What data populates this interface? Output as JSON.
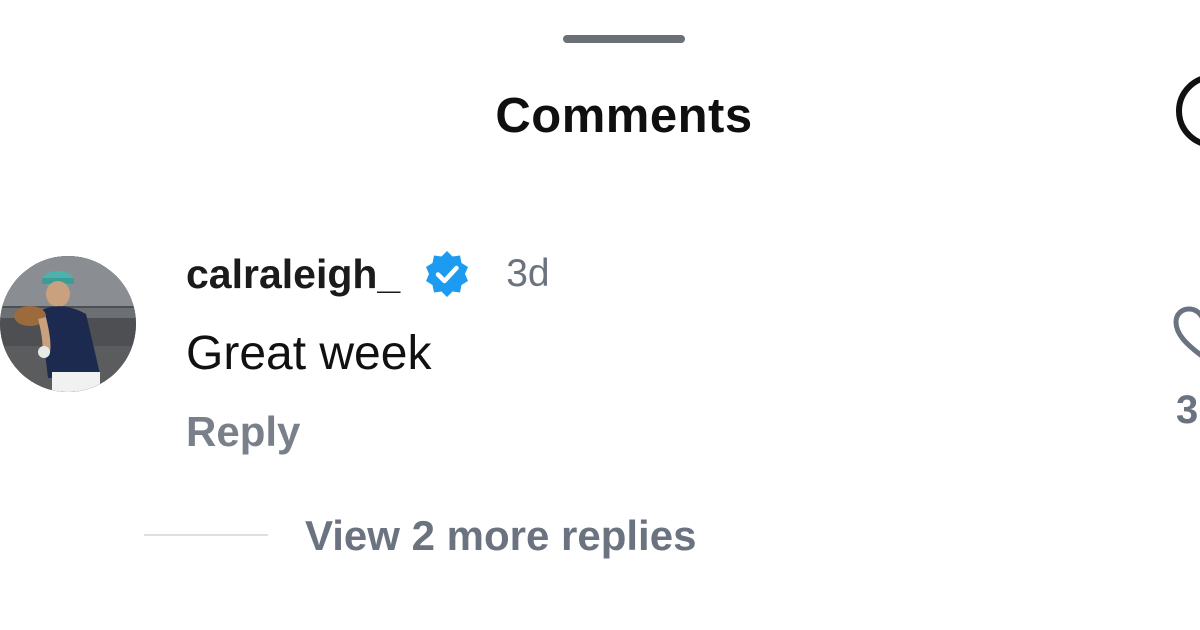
{
  "sheet": {
    "title": "Comments"
  },
  "comment": {
    "username": "calraleigh_",
    "verified": true,
    "timestamp": "3d",
    "text": "Great week",
    "reply_label": "Reply",
    "view_replies_label": "View 2 more replies",
    "like_count": "3"
  },
  "icons": {
    "verified_badge": "verified-badge-icon",
    "like": "heart-icon",
    "cut_off_circle": "circle-icon"
  },
  "colors": {
    "verified_blue": "#1d9bf0",
    "secondary_text": "#6b7280"
  }
}
